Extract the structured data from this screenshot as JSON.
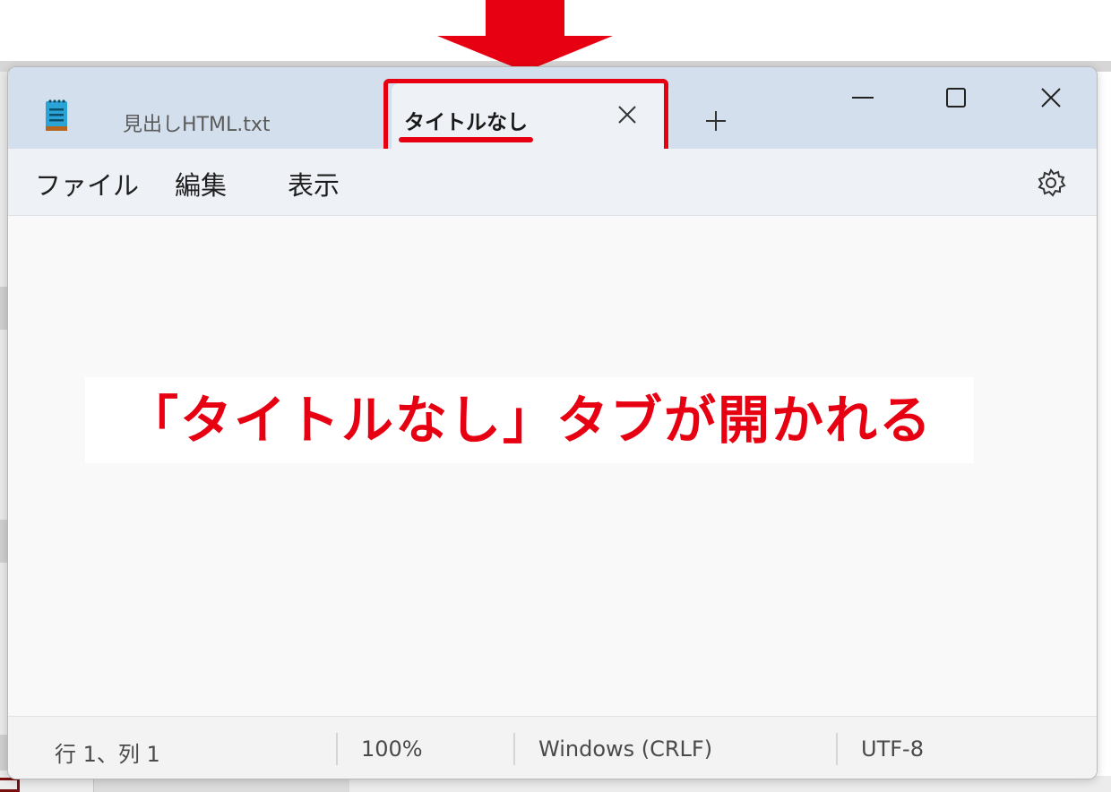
{
  "tabs": [
    {
      "label": "見出しHTML.txt",
      "active": false
    },
    {
      "label": "タイトルなし",
      "active": true
    }
  ],
  "icons": {
    "app": "notepad-icon",
    "tab_close": "close-icon",
    "new_tab": "plus-icon",
    "minimize": "minimize-icon",
    "maximize": "maximize-icon",
    "close": "close-icon",
    "settings": "gear-icon",
    "annotation": "arrow-down-icon"
  },
  "menu": {
    "file": "ファイル",
    "edit": "編集",
    "view": "表示"
  },
  "annotation": {
    "caption": "「タイトルなし」タブが開かれる",
    "color": "#e60012"
  },
  "status": {
    "position": "行 1、列 1",
    "zoom": "100%",
    "line_ending": "Windows (CRLF)",
    "encoding": "UTF-8"
  },
  "colors": {
    "titlebar": "#d3dfec",
    "active_tab": "#eef2f7",
    "highlight": "#e60012"
  }
}
